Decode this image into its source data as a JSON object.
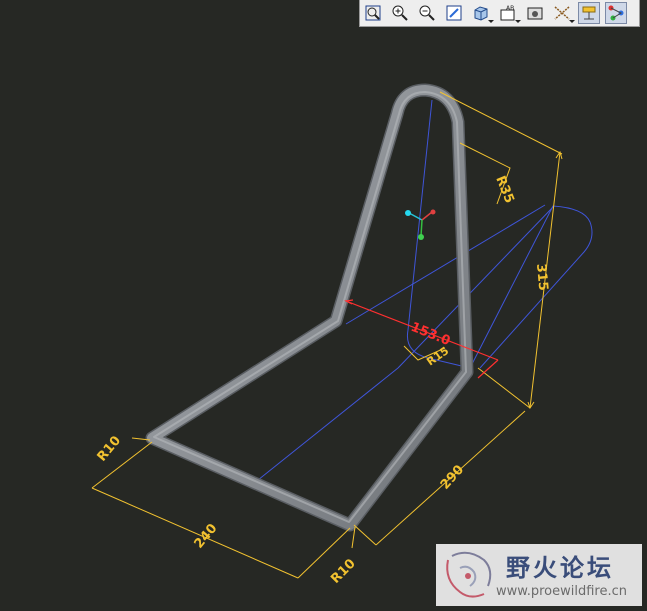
{
  "toolbar": {
    "buttons": [
      {
        "name": "refit-icon"
      },
      {
        "name": "zoom-in-icon"
      },
      {
        "name": "zoom-out-icon"
      },
      {
        "name": "repaint-icon"
      },
      {
        "name": "display-style-icon"
      },
      {
        "name": "saved-views-icon"
      },
      {
        "name": "view-manager-icon"
      },
      {
        "name": "datum-display-icon"
      },
      {
        "name": "annotation-display-icon"
      },
      {
        "name": "spin-center-icon"
      }
    ]
  },
  "dimensions": {
    "radius_top": "R35",
    "height": "315",
    "depth": "290",
    "width": "240",
    "radius_left": "R10",
    "radius_bottom": "R10",
    "angle": "153.0",
    "radius_inner": "R15"
  },
  "colors": {
    "background": "#262824",
    "tube": "#8d9196",
    "dimension": "#f2c230",
    "selected_dimension": "#ff3030",
    "sketch_line": "#3f55d8"
  },
  "watermark": {
    "title": "野火论坛",
    "url": "www.proewildfire.cn"
  }
}
